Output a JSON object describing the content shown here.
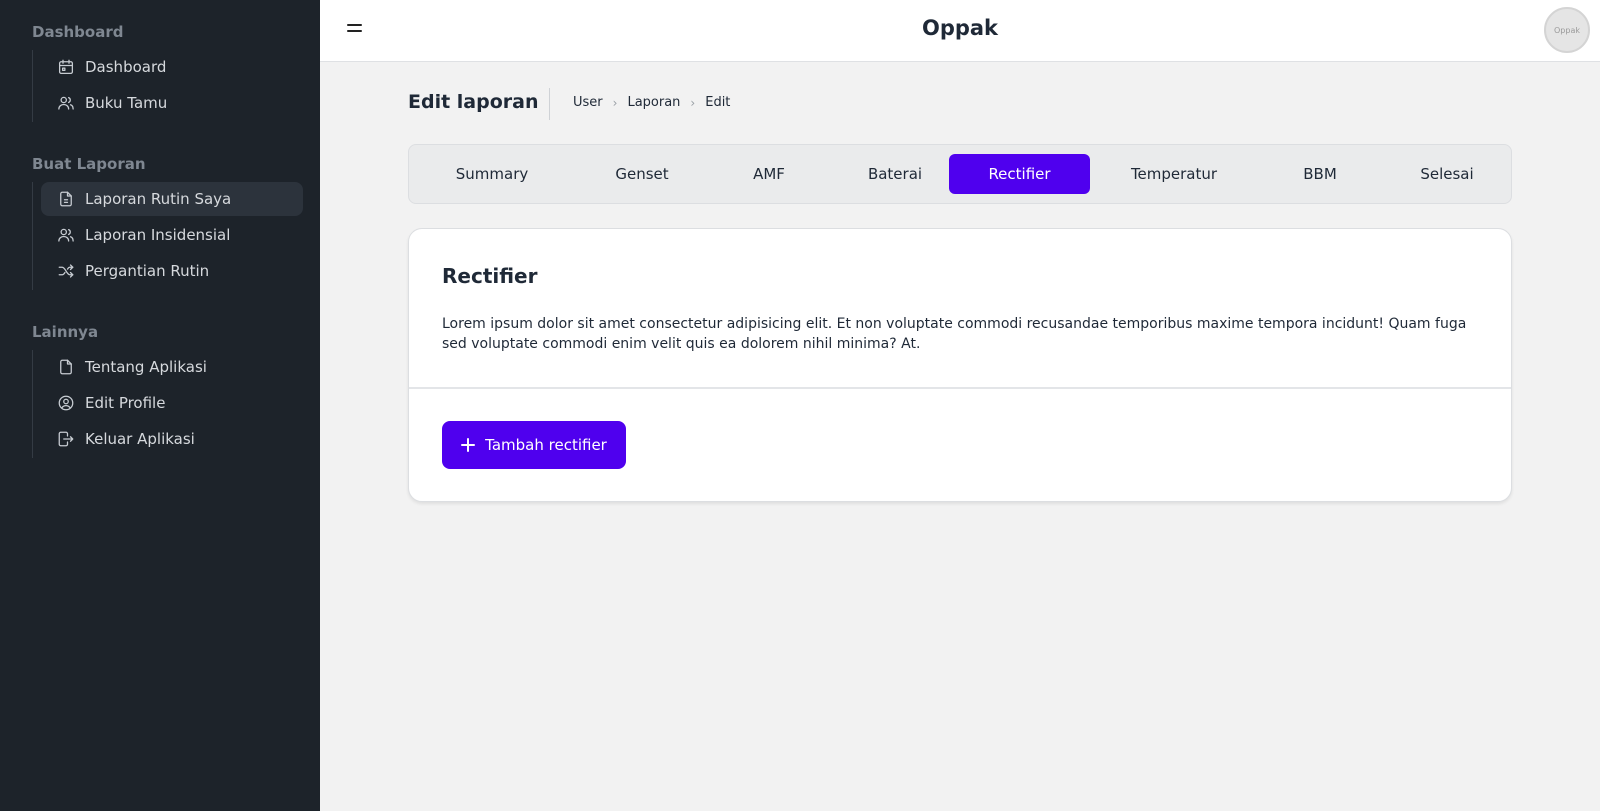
{
  "sidebar": {
    "sections": [
      {
        "title": "Dashboard",
        "items": [
          {
            "label": "Dashboard",
            "icon": "calendar-icon"
          },
          {
            "label": "Buku Tamu",
            "icon": "users-icon"
          }
        ]
      },
      {
        "title": "Buat Laporan",
        "items": [
          {
            "label": "Laporan Rutin Saya",
            "icon": "file-report-icon",
            "active": true
          },
          {
            "label": "Laporan Insidensial",
            "icon": "users-icon"
          },
          {
            "label": "Pergantian Rutin",
            "icon": "shuffle-icon"
          }
        ]
      },
      {
        "title": "Lainnya",
        "items": [
          {
            "label": "Tentang Aplikasi",
            "icon": "file-icon"
          },
          {
            "label": "Edit Profile",
            "icon": "user-circle-icon"
          },
          {
            "label": "Keluar Aplikasi",
            "icon": "logout-icon"
          }
        ]
      }
    ]
  },
  "topbar": {
    "app_title": "Oppak",
    "avatar_text": "Oppak",
    "menu_icon": "hamburger-icon"
  },
  "header": {
    "title": "Edit laporan",
    "breadcrumb": [
      "User",
      "Laporan",
      "Edit"
    ]
  },
  "tabs": {
    "items": [
      "Summary",
      "Genset",
      "AMF",
      "Baterai",
      "Rectifier",
      "Temperatur",
      "BBM",
      "Selesai"
    ],
    "active": "Rectifier"
  },
  "card": {
    "title": "Rectifier",
    "description": "Lorem ipsum dolor sit amet consectetur adipisicing elit. Et non voluptate commodi recusandae temporibus maxime tempora incidunt! Quam fuga sed voluptate commodi enim velit quis ea dolorem nihil minima? At.",
    "add_button_label": "Tambah rectifier",
    "add_button_icon": "plus-icon"
  },
  "colors": {
    "accent": "#4f00ee",
    "sidebar_bg": "#1d232a",
    "page_bg": "#f2f2f2"
  }
}
